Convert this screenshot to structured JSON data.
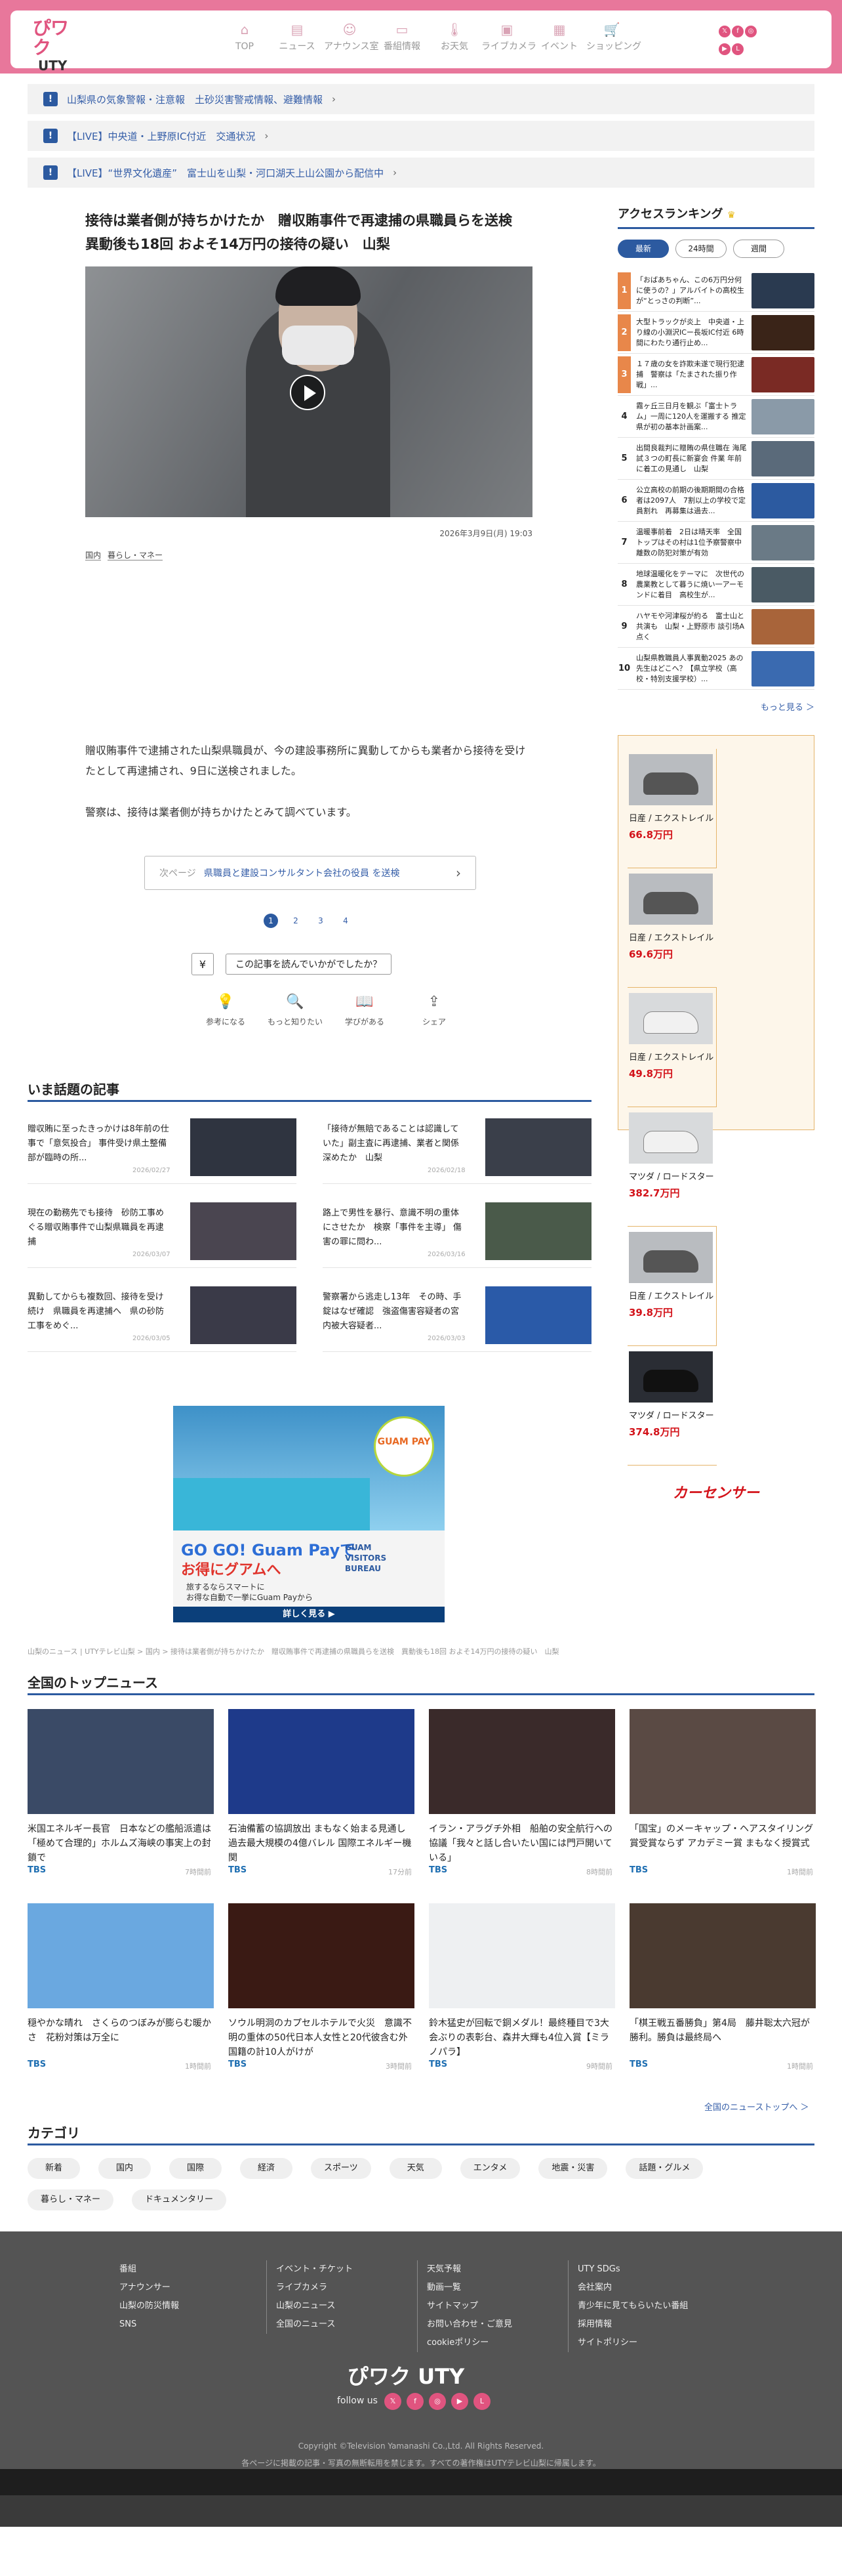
{
  "header": {
    "logo_top": "ぴワク",
    "logo_bottom": "UTY",
    "nav": [
      {
        "label": "TOP",
        "icon": "home-icon",
        "glyph": "⌂"
      },
      {
        "label": "ニュース",
        "icon": "newspaper-icon",
        "glyph": "▤"
      },
      {
        "label": "アナウンス室",
        "icon": "person-icon",
        "glyph": "☺"
      },
      {
        "label": "番組情報",
        "icon": "tv-icon",
        "glyph": "▭"
      },
      {
        "label": "お天気",
        "icon": "thermometer-icon",
        "glyph": "🌡"
      },
      {
        "label": "ライブカメラ",
        "icon": "camera-icon",
        "glyph": "▣"
      },
      {
        "label": "イベント",
        "icon": "calendar-icon",
        "glyph": "▦"
      },
      {
        "label": "ショッピング",
        "icon": "cart-icon",
        "glyph": "🛒"
      }
    ]
  },
  "alerts": [
    {
      "text": "山梨県の気象警報・注意報　土砂災害警戒情報、避難情報"
    },
    {
      "text": "【LIVE】中央道・上野原IC付近　交通状況"
    },
    {
      "text": "【LIVE】“世界文化遺産”　富士山を山梨・河口湖天上山公園から配信中"
    }
  ],
  "article": {
    "title": "接待は業者側が持ちかけたか　贈収賄事件で再逮捕の県職員らを送検　異動後も18回 およそ14万円の接待の疑い　山梨",
    "date": "2026年3月9日(月) 19:03",
    "tags": [
      "国内",
      "暮らし・マネー"
    ],
    "paragraph1": "贈収賄事件で逮捕された山梨県職員が、今の建設事務所に異動してからも業者から接待を受けたとして再逮捕され、9日に送検されました。",
    "paragraph2": "警察は、接待は業者側が持ちかけたとみて調べています。",
    "next_label": "次ページ",
    "next_text": "県職員と建設コンサルタント会社の役員 を送検",
    "pages": [
      "1",
      "2",
      "3",
      "4"
    ],
    "survey": "この記事を読んでいかがでしたか？",
    "reactions": [
      {
        "label": "参考になる",
        "glyph": "💡",
        "icon": "lightbulb-icon"
      },
      {
        "label": "もっと知りたい",
        "glyph": "🔍",
        "icon": "search-icon"
      },
      {
        "label": "学びがある",
        "glyph": "📖",
        "icon": "book-icon"
      },
      {
        "label": "シェア",
        "glyph": "⇪",
        "icon": "share-icon"
      }
    ]
  },
  "ranking": {
    "title": "アクセスランキング",
    "tabs": [
      "最新",
      "24時間",
      "週間"
    ],
    "items": [
      {
        "no": "1",
        "text": "「おばあちゃん、この6万円分何に使うの？」アルバイトの高校生が“とっさの判断”...",
        "color": "#2a3a50"
      },
      {
        "no": "2",
        "text": "大型トラックが炎上　中央道・上り線の小淵沢ICー長坂IC付近 6時間にわたり通行止め...",
        "color": "#3a2418"
      },
      {
        "no": "3",
        "text": "１７歳の女を詐欺未遂で現行犯逮捕　警察は「たまされた振り作戦」...",
        "color": "#7a2a24"
      },
      {
        "no": "4",
        "text": "霧ヶ丘三日月を観ぶ「富士トラム」一周に120人を運搬する 推定　県が初の基本計画案...",
        "color": "#8a9aa8"
      },
      {
        "no": "5",
        "text": "出間良裁判に贈賄の県住職在 海尾試３つの町長に新宴会 件業 年前に着工の見通し　山梨",
        "color": "#5a6a7a"
      },
      {
        "no": "6",
        "text": "公立高校の前期の後期期間の合格者は2097人　7割以上の学校で定員割れ　再募集は過去...",
        "color": "#2c5aa0"
      },
      {
        "no": "7",
        "text": "温暖事前着　2日は晴天率　全国トップはその村は1位予察警察中　離数の防犯対策が有効",
        "color": "#6a7a86"
      },
      {
        "no": "8",
        "text": "地球温暖化をテーマに　次世代の農業教として暮うに焼い一アーモンドに着目　高校生が...",
        "color": "#4a5a64"
      },
      {
        "no": "9",
        "text": "ハヤモや河津桜が約る　富士山と共演も　山梨・上野原市 談引场A点く",
        "color": "#a8643a"
      },
      {
        "no": "10",
        "text": "山梨県教職員人事異動2025 あの先生はどこへ？【県立学校（高校・特別支援学校）...",
        "color": "#3a6ab0"
      }
    ],
    "more": "もっと見る ＞"
  },
  "car_ad": {
    "cars": [
      {
        "name": "日産 / エクストレイル",
        "price": "66.8万円",
        "tone": "gray"
      },
      {
        "name": "日産 / エクストレイル",
        "price": "69.6万円",
        "tone": "gray"
      },
      {
        "name": "日産 / エクストレイル",
        "price": "49.8万円",
        "tone": "white"
      },
      {
        "name": "マツダ / ロードスター",
        "price": "382.7万円",
        "tone": "white"
      },
      {
        "name": "日産 / エクストレイル",
        "price": "39.8万円",
        "tone": "gray"
      },
      {
        "name": "マツダ / ロードスター",
        "price": "374.8万円",
        "tone": "black"
      }
    ],
    "brand": "カーセンサー"
  },
  "trending": {
    "title": "いま話題の記事",
    "items": [
      {
        "text": "贈収賄に至ったきっかけは8年前の仕事で「意気投合」 事件受け県土整備部が臨時の所...",
        "date": "2026/02/27",
        "color": "#2f3440"
      },
      {
        "text": "「接待が無賠であることは認識していた」副主査に再逮捕、業者と関係深めたか　山梨",
        "date": "2026/02/18",
        "color": "#3a3f4a"
      },
      {
        "text": "現在の勤務先でも接待　砂防工事めぐる贈収賄事件で山梨県職員を再逮捕",
        "date": "2026/03/07",
        "color": "#4a4550"
      },
      {
        "text": "路上で男性を暴行、意識不明の重体にさせたか　検察「事件を主導」 傷害の罪に問わ...",
        "date": "2026/03/16",
        "color": "#4a5a4a"
      },
      {
        "text": "異動してからも複数回、接待を受け続け　県職員を再逮捕へ　県の砂防工事をめぐ...",
        "date": "2026/03/05",
        "color": "#3a3a48"
      },
      {
        "text": "警察署から逃走し13年　その時、手錠はなぜ確認　強盗傷害容疑者の宮内被大容疑者...",
        "date": "2026/03/03",
        "color": "#2a5aa8"
      }
    ]
  },
  "guam_ad": {
    "pay": "GUAM PAY",
    "headline1": "GO GO! Guam Payで",
    "headline2": "お得にグアムへ",
    "sub": "旅するならスマートに\nお得な自動で一挙にGuam Payから",
    "bureau": "GUAM\nVISITORS\nBUREAU",
    "cta": "詳しく見る ▶"
  },
  "breadcrumb": "山梨のニュース | UTYテレビ山梨 > 国内 > 接待は業者側が持ちかけたか　贈収賄事件で再逮捕の県職員らを送検　異動後も18回 およそ14万円の接待の疑い　山梨",
  "national": {
    "title": "全国のトップニュース",
    "items": [
      {
        "text": "米国エネルギー長官　日本などの艦船派遣は「極めて合理的」ホルムズ海峡の事実上の封鎖で",
        "src": "TBS",
        "date": "7時間前",
        "color": "#3a4a66"
      },
      {
        "text": "石油備蓄の協調放出 まもなく始まる見通し 過去最大規模の4億バレル 国際エネルギー機関",
        "src": "TBS",
        "date": "17分前",
        "color": "#1e3a8a"
      },
      {
        "text": "イラン・アラグチ外相　船舶の安全航行への協議「我々と話し合いたい国には門戸開いている」",
        "src": "TBS",
        "date": "8時間前",
        "color": "#3a2a2a"
      },
      {
        "text": "「国宝」のメーキャップ・ヘアスタイリング賞受賞ならず アカデミー賞 まもなく授賞式",
        "src": "TBS",
        "date": "1時間前",
        "color": "#5a4a44"
      },
      {
        "text": "穏やかな晴れ　さくらのつぼみが膨らむ暖かさ　花粉対策は万全に",
        "src": "TBS",
        "date": "1時間前",
        "color": "#6aa8e0"
      },
      {
        "text": "ソウル明洞のカプセルホテルで火災　意識不明の重体の50代日本人女性と20代彼含む外国籍の計10人がけが",
        "src": "TBS",
        "date": "3時間前",
        "color": "#3a1a14"
      },
      {
        "text": "鈴木猛史が回転で銅メダル！最終種目で3大会ぶりの表彰台、森井大輝も4位入賞【ミラノパラ】",
        "src": "TBS",
        "date": "9時間前",
        "color": "#eef0f2"
      },
      {
        "text": "「棋王戦五番勝負」第4局　藤井聡太六冠が勝利。勝負は最終局へ",
        "src": "TBS",
        "date": "1時間前",
        "color": "#4a3a30"
      }
    ],
    "more": "全国のニューストップへ ＞"
  },
  "categories": {
    "title": "カテゴリ",
    "items": [
      "新着",
      "国内",
      "国際",
      "経済",
      "スポーツ",
      "天気",
      "エンタメ",
      "地震・災害",
      "話題・グルメ",
      "暮らし・マネー",
      "ドキュメンタリー"
    ]
  },
  "footer": {
    "col1": [
      "番組",
      "アナウンサー",
      "山梨の防災情報",
      "SNS"
    ],
    "col2": [
      "イベント・チケット",
      "ライブカメラ",
      "山梨のニュース",
      "全国のニュース"
    ],
    "col3": [
      "天気予報",
      "動画一覧",
      "サイトマップ",
      "お問い合わせ・ご意見",
      "cookieポリシー"
    ],
    "col4": [
      "UTY SDGs",
      "会社案内",
      "青少年に見てもらいたい番組",
      "採用情報",
      "サイトポリシー"
    ],
    "logo": "ぴワク UTY",
    "follow": "follow us",
    "copyright": "Copyright ©Television Yamanashi Co.,Ltd. All Rights Reserved.",
    "note": "各ページに掲載の記事・写真の無断転用を禁じます。すべての著作権はUTYテレビ山梨に帰属します。"
  },
  "colors": {
    "brand": "#e8779b",
    "accent": "#2c5aa0"
  }
}
